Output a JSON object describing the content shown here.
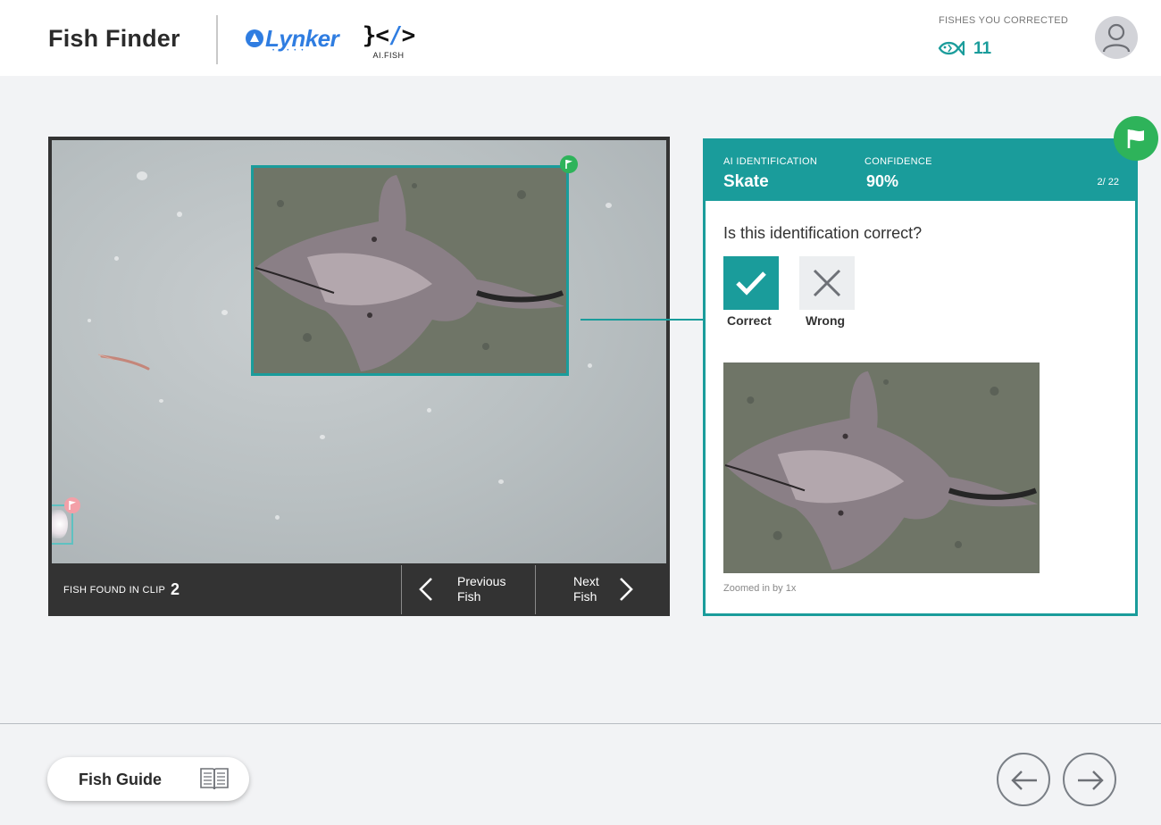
{
  "header": {
    "app_title": "Fish Finder",
    "lynker_logo_text": "Lynker",
    "aifish_logo_text": "AI.FISH",
    "corrected_label": "FISHES YOU CORRECTED",
    "corrected_count": "11"
  },
  "viewer": {
    "found_label": "FISH FOUND IN CLIP",
    "found_count": "2",
    "prev_line1": "Previous",
    "prev_line2": "Fish",
    "next_line1": "Next",
    "next_line2": "Fish"
  },
  "card": {
    "ai_label": "AI IDENTIFICATION",
    "ai_value": "Skate",
    "confidence_label": "CONFIDENCE",
    "confidence_value": "90%",
    "page_count": "2/ 22",
    "question": "Is this identification correct?",
    "correct_label": "Correct",
    "wrong_label": "Wrong",
    "zoom_text": "Zoomed in by 1x"
  },
  "footer": {
    "guide_label": "Fish Guide"
  },
  "colors": {
    "accent": "#1a9c9b",
    "flag_green": "#2eb35a",
    "flag_pink": "#f3a0a8",
    "dark_bar": "#333333"
  },
  "icons": {
    "fish": "fish-icon",
    "avatar": "user-avatar-icon",
    "flag": "flag-icon",
    "check": "check-icon",
    "close": "close-icon",
    "chevron_left": "chevron-left-icon",
    "chevron_right": "chevron-right-icon",
    "book": "book-icon",
    "arrow_left": "arrow-left-icon",
    "arrow_right": "arrow-right-icon"
  }
}
